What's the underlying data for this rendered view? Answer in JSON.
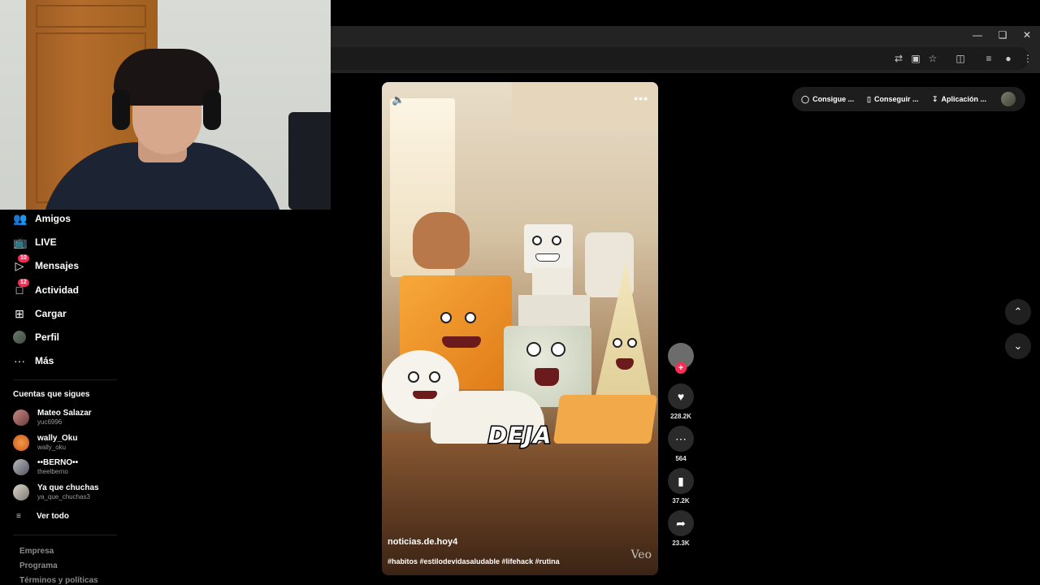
{
  "sidebar": {
    "items": [
      {
        "label": "Amigos",
        "icon": "friends-icon"
      },
      {
        "label": "LIVE",
        "icon": "live-icon"
      },
      {
        "label": "Mensajes",
        "icon": "messages-icon",
        "badge": "10"
      },
      {
        "label": "Actividad",
        "icon": "activity-icon",
        "badge": "12"
      },
      {
        "label": "Cargar",
        "icon": "upload-icon"
      },
      {
        "label": "Perfil",
        "icon": "profile-avatar"
      },
      {
        "label": "Más",
        "icon": "more-icon"
      }
    ],
    "following_title": "Cuentas que sigues",
    "following": [
      {
        "name": "Mateo Salazar",
        "handle": "yuc6996"
      },
      {
        "name": "wally_Oku",
        "handle": "wally_oku"
      },
      {
        "name": "••BERNO••",
        "handle": "theelberno"
      },
      {
        "name": "Ya que chuchas",
        "handle": "ya_que_chuchas3"
      }
    ],
    "see_all": "Ver todo",
    "footer": [
      "Empresa",
      "Programa",
      "Términos y políticas"
    ]
  },
  "video": {
    "caption_overlay": "DEJA",
    "author": "noticias.de.hoy4",
    "hashtags": "#habitos #estilodevidasaludable #lifehack #rutina",
    "watermark": "Veo"
  },
  "actions": {
    "likes": "228.2K",
    "comments": "564",
    "saves": "37.2K",
    "shares": "23.3K"
  },
  "topbar": {
    "items": [
      "Consigue ...",
      "Conseguir ...",
      "Aplicación ..."
    ]
  },
  "colors": {
    "accent": "#fe2c55",
    "background": "#000000"
  }
}
